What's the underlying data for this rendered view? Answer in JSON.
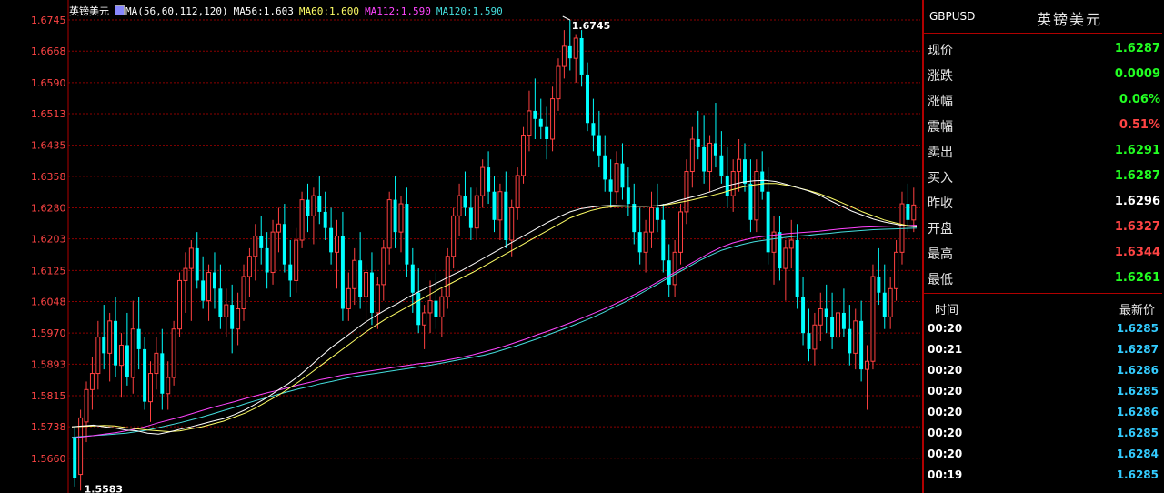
{
  "chart_data": {
    "type": "candlestick",
    "symbol_title": "英镑美元",
    "legend": {
      "ma_params": "MA(56,60,112,120)",
      "ma56": "MA56:1.603",
      "ma60": "MA60:1.600",
      "ma112": "MA112:1.590",
      "ma120": "MA120:1.590"
    },
    "y_ticks": [
      "1.6745",
      "1.6668",
      "1.6590",
      "1.6513",
      "1.6435",
      "1.6358",
      "1.6280",
      "1.6203",
      "1.6125",
      "1.6048",
      "1.5970",
      "1.5893",
      "1.5815",
      "1.5738",
      "1.5660"
    ],
    "ylim": [
      1.5583,
      1.6745
    ],
    "high_label": "1.6745",
    "low_label": "1.5583",
    "colors": {
      "up": "#ff4040",
      "down": "#00ffff",
      "ma56": "#ffffff",
      "ma60": "#ffff66",
      "ma112": "#ff44ff",
      "ma120": "#44dddd",
      "grid": "#8b0000"
    },
    "candles": [
      [
        1.571,
        1.574,
        1.559,
        1.561
      ],
      [
        1.562,
        1.578,
        1.558,
        1.576
      ],
      [
        1.575,
        1.585,
        1.57,
        1.583
      ],
      [
        1.583,
        1.591,
        1.578,
        1.587
      ],
      [
        1.587,
        1.6,
        1.583,
        1.596
      ],
      [
        1.596,
        1.604,
        1.588,
        1.592
      ],
      [
        1.592,
        1.602,
        1.585,
        1.6
      ],
      [
        1.6,
        1.606,
        1.586,
        1.589
      ],
      [
        1.589,
        1.597,
        1.581,
        1.594
      ],
      [
        1.594,
        1.602,
        1.584,
        1.586
      ],
      [
        1.586,
        1.605,
        1.582,
        1.598
      ],
      [
        1.598,
        1.606,
        1.588,
        1.593
      ],
      [
        1.593,
        1.596,
        1.578,
        1.58
      ],
      [
        1.58,
        1.59,
        1.575,
        1.587
      ],
      [
        1.587,
        1.596,
        1.583,
        1.592
      ],
      [
        1.592,
        1.598,
        1.578,
        1.582
      ],
      [
        1.582,
        1.59,
        1.578,
        1.586
      ],
      [
        1.586,
        1.6,
        1.584,
        1.598
      ],
      [
        1.598,
        1.612,
        1.596,
        1.61
      ],
      [
        1.61,
        1.617,
        1.602,
        1.613
      ],
      [
        1.613,
        1.62,
        1.6,
        1.618
      ],
      [
        1.618,
        1.622,
        1.608,
        1.61
      ],
      [
        1.61,
        1.616,
        1.603,
        1.605
      ],
      [
        1.605,
        1.614,
        1.6,
        1.612
      ],
      [
        1.612,
        1.617,
        1.603,
        1.608
      ],
      [
        1.608,
        1.614,
        1.598,
        1.601
      ],
      [
        1.601,
        1.608,
        1.596,
        1.604
      ],
      [
        1.604,
        1.609,
        1.592,
        1.598
      ],
      [
        1.598,
        1.607,
        1.594,
        1.603
      ],
      [
        1.603,
        1.614,
        1.6,
        1.611
      ],
      [
        1.611,
        1.618,
        1.606,
        1.616
      ],
      [
        1.616,
        1.624,
        1.61,
        1.621
      ],
      [
        1.621,
        1.626,
        1.614,
        1.618
      ],
      [
        1.618,
        1.622,
        1.608,
        1.612
      ],
      [
        1.612,
        1.625,
        1.609,
        1.622
      ],
      [
        1.622,
        1.628,
        1.617,
        1.624
      ],
      [
        1.624,
        1.629,
        1.612,
        1.614
      ],
      [
        1.614,
        1.62,
        1.606,
        1.61
      ],
      [
        1.61,
        1.623,
        1.607,
        1.62
      ],
      [
        1.62,
        1.632,
        1.618,
        1.63
      ],
      [
        1.63,
        1.634,
        1.622,
        1.626
      ],
      [
        1.626,
        1.633,
        1.619,
        1.631
      ],
      [
        1.631,
        1.636,
        1.624,
        1.627
      ],
      [
        1.627,
        1.632,
        1.62,
        1.623
      ],
      [
        1.623,
        1.628,
        1.614,
        1.617
      ],
      [
        1.617,
        1.625,
        1.608,
        1.621
      ],
      [
        1.621,
        1.627,
        1.6,
        1.603
      ],
      [
        1.603,
        1.612,
        1.6,
        1.608
      ],
      [
        1.608,
        1.618,
        1.604,
        1.615
      ],
      [
        1.615,
        1.622,
        1.603,
        1.606
      ],
      [
        1.606,
        1.614,
        1.598,
        1.612
      ],
      [
        1.612,
        1.617,
        1.599,
        1.602
      ],
      [
        1.602,
        1.611,
        1.598,
        1.609
      ],
      [
        1.609,
        1.62,
        1.605,
        1.618
      ],
      [
        1.618,
        1.632,
        1.614,
        1.63
      ],
      [
        1.63,
        1.636,
        1.618,
        1.622
      ],
      [
        1.622,
        1.631,
        1.617,
        1.629
      ],
      [
        1.629,
        1.633,
        1.611,
        1.614
      ],
      [
        1.614,
        1.618,
        1.602,
        1.607
      ],
      [
        1.607,
        1.613,
        1.597,
        1.599
      ],
      [
        1.599,
        1.604,
        1.593,
        1.602
      ],
      [
        1.602,
        1.61,
        1.597,
        1.605
      ],
      [
        1.605,
        1.612,
        1.598,
        1.601
      ],
      [
        1.601,
        1.608,
        1.596,
        1.606
      ],
      [
        1.606,
        1.618,
        1.603,
        1.616
      ],
      [
        1.616,
        1.628,
        1.613,
        1.626
      ],
      [
        1.626,
        1.634,
        1.621,
        1.631
      ],
      [
        1.631,
        1.637,
        1.626,
        1.628
      ],
      [
        1.628,
        1.633,
        1.62,
        1.623
      ],
      [
        1.623,
        1.633,
        1.62,
        1.631
      ],
      [
        1.631,
        1.64,
        1.628,
        1.638
      ],
      [
        1.638,
        1.642,
        1.629,
        1.632
      ],
      [
        1.632,
        1.636,
        1.622,
        1.625
      ],
      [
        1.625,
        1.634,
        1.62,
        1.632
      ],
      [
        1.632,
        1.637,
        1.618,
        1.62
      ],
      [
        1.62,
        1.63,
        1.616,
        1.628
      ],
      [
        1.628,
        1.638,
        1.625,
        1.636
      ],
      [
        1.636,
        1.648,
        1.634,
        1.646
      ],
      [
        1.646,
        1.657,
        1.642,
        1.652
      ],
      [
        1.652,
        1.66,
        1.645,
        1.65
      ],
      [
        1.65,
        1.655,
        1.645,
        1.648
      ],
      [
        1.648,
        1.653,
        1.64,
        1.645
      ],
      [
        1.645,
        1.658,
        1.642,
        1.655
      ],
      [
        1.655,
        1.665,
        1.652,
        1.663
      ],
      [
        1.663,
        1.672,
        1.66,
        1.668
      ],
      [
        1.668,
        1.6745,
        1.662,
        1.665
      ],
      [
        1.665,
        1.671,
        1.659,
        1.67
      ],
      [
        1.67,
        1.672,
        1.658,
        1.661
      ],
      [
        1.661,
        1.664,
        1.647,
        1.649
      ],
      [
        1.649,
        1.655,
        1.642,
        1.646
      ],
      [
        1.646,
        1.652,
        1.638,
        1.641
      ],
      [
        1.641,
        1.646,
        1.632,
        1.635
      ],
      [
        1.635,
        1.64,
        1.628,
        1.632
      ],
      [
        1.632,
        1.642,
        1.629,
        1.639
      ],
      [
        1.639,
        1.644,
        1.63,
        1.633
      ],
      [
        1.633,
        1.638,
        1.626,
        1.629
      ],
      [
        1.629,
        1.634,
        1.619,
        1.622
      ],
      [
        1.622,
        1.628,
        1.614,
        1.617
      ],
      [
        1.617,
        1.625,
        1.612,
        1.622
      ],
      [
        1.622,
        1.632,
        1.618,
        1.628
      ],
      [
        1.628,
        1.634,
        1.622,
        1.625
      ],
      [
        1.625,
        1.629,
        1.612,
        1.615
      ],
      [
        1.615,
        1.619,
        1.606,
        1.609
      ],
      [
        1.609,
        1.62,
        1.606,
        1.617
      ],
      [
        1.617,
        1.629,
        1.614,
        1.627
      ],
      [
        1.627,
        1.64,
        1.624,
        1.637
      ],
      [
        1.637,
        1.648,
        1.633,
        1.645
      ],
      [
        1.645,
        1.652,
        1.64,
        1.643
      ],
      [
        1.643,
        1.651,
        1.634,
        1.637
      ],
      [
        1.637,
        1.646,
        1.632,
        1.644
      ],
      [
        1.644,
        1.654,
        1.638,
        1.641
      ],
      [
        1.641,
        1.647,
        1.634,
        1.636
      ],
      [
        1.636,
        1.643,
        1.628,
        1.631
      ],
      [
        1.631,
        1.64,
        1.627,
        1.637
      ],
      [
        1.637,
        1.645,
        1.632,
        1.64
      ],
      [
        1.64,
        1.644,
        1.632,
        1.634
      ],
      [
        1.634,
        1.64,
        1.622,
        1.625
      ],
      [
        1.625,
        1.64,
        1.622,
        1.637
      ],
      [
        1.637,
        1.642,
        1.63,
        1.632
      ],
      [
        1.632,
        1.638,
        1.614,
        1.617
      ],
      [
        1.617,
        1.626,
        1.609,
        1.622
      ],
      [
        1.622,
        1.626,
        1.61,
        1.613
      ],
      [
        1.613,
        1.62,
        1.605,
        1.618
      ],
      [
        1.618,
        1.625,
        1.613,
        1.62
      ],
      [
        1.62,
        1.624,
        1.603,
        1.606
      ],
      [
        1.606,
        1.611,
        1.594,
        1.597
      ],
      [
        1.597,
        1.603,
        1.59,
        1.593
      ],
      [
        1.593,
        1.602,
        1.589,
        1.599
      ],
      [
        1.599,
        1.607,
        1.595,
        1.603
      ],
      [
        1.603,
        1.609,
        1.597,
        1.601
      ],
      [
        1.601,
        1.607,
        1.593,
        1.596
      ],
      [
        1.596,
        1.604,
        1.592,
        1.602
      ],
      [
        1.602,
        1.608,
        1.596,
        1.598
      ],
      [
        1.598,
        1.604,
        1.589,
        1.592
      ],
      [
        1.592,
        1.603,
        1.588,
        1.6
      ],
      [
        1.6,
        1.605,
        1.585,
        1.588
      ],
      [
        1.588,
        1.594,
        1.578,
        1.59
      ],
      [
        1.59,
        1.614,
        1.588,
        1.611
      ],
      [
        1.611,
        1.618,
        1.604,
        1.607
      ],
      [
        1.607,
        1.614,
        1.598,
        1.601
      ],
      [
        1.601,
        1.611,
        1.598,
        1.608
      ],
      [
        1.608,
        1.62,
        1.605,
        1.617
      ],
      [
        1.617,
        1.632,
        1.614,
        1.629
      ],
      [
        1.629,
        1.634,
        1.622,
        1.625
      ],
      [
        1.625,
        1.633,
        1.622,
        1.6287
      ]
    ],
    "ma56": [
      1.5738,
      1.574,
      1.5742,
      1.5738,
      1.5735,
      1.573,
      1.5728,
      1.5722,
      1.572,
      1.5725,
      1.5732,
      1.5738,
      1.5745,
      1.5752,
      1.5758,
      1.5768,
      1.578,
      1.5795,
      1.581,
      1.5828,
      1.5845,
      1.5865,
      1.5888,
      1.5912,
      1.5935,
      1.5955,
      1.5975,
      1.5995,
      1.6012,
      1.6028,
      1.6042,
      1.6058,
      1.6072,
      1.6085,
      1.6098,
      1.6112,
      1.6125,
      1.614,
      1.6155,
      1.617,
      1.6185,
      1.62,
      1.6215,
      1.623,
      1.6245,
      1.6258,
      1.627,
      1.6278,
      1.6282,
      1.6285,
      1.6286,
      1.6285,
      1.6284,
      1.6284,
      1.6285,
      1.629,
      1.6298,
      1.6305,
      1.6312,
      1.632,
      1.633,
      1.6338,
      1.6344,
      1.6347,
      1.6348,
      1.6345,
      1.6338,
      1.633,
      1.6322,
      1.6312,
      1.6298,
      1.6285,
      1.6272,
      1.6262,
      1.6252,
      1.6245,
      1.624,
      1.6235,
      1.6233
    ],
    "ma60": [
      1.5738,
      1.5739,
      1.574,
      1.5741,
      1.574,
      1.5736,
      1.5733,
      1.573,
      1.5728,
      1.5726,
      1.5728,
      1.5733,
      1.5738,
      1.5745,
      1.5752,
      1.5762,
      1.5772,
      1.5785,
      1.58,
      1.5815,
      1.5832,
      1.585,
      1.587,
      1.589,
      1.591,
      1.593,
      1.595,
      1.597,
      1.5988,
      1.6005,
      1.602,
      1.6035,
      1.605,
      1.6065,
      1.608,
      1.6093,
      1.6107,
      1.612,
      1.6135,
      1.615,
      1.6165,
      1.618,
      1.6195,
      1.621,
      1.6225,
      1.624,
      1.6255,
      1.6265,
      1.6274,
      1.628,
      1.6283,
      1.6284,
      1.6284,
      1.6284,
      1.6285,
      1.6288,
      1.6293,
      1.6298,
      1.6304,
      1.631,
      1.6317,
      1.6325,
      1.6332,
      1.6337,
      1.634,
      1.634,
      1.6336,
      1.633,
      1.6323,
      1.6315,
      1.6305,
      1.6294,
      1.6282,
      1.627,
      1.626,
      1.625,
      1.6243,
      1.6237,
      1.6233
    ],
    "ma112": [
      1.571,
      1.5713,
      1.5716,
      1.572,
      1.5723,
      1.5728,
      1.5733,
      1.574,
      1.5748,
      1.5755,
      1.5762,
      1.577,
      1.5778,
      1.5786,
      1.5793,
      1.58,
      1.5808,
      1.5815,
      1.5822,
      1.5828,
      1.5835,
      1.5842,
      1.5848,
      1.5855,
      1.586,
      1.5866,
      1.587,
      1.5874,
      1.5878,
      1.5882,
      1.5886,
      1.589,
      1.5894,
      1.5897,
      1.59,
      1.5905,
      1.591,
      1.5916,
      1.5923,
      1.593,
      1.5938,
      1.5947,
      1.5956,
      1.5966,
      1.5975,
      1.5985,
      1.5995,
      1.6006,
      1.6017,
      1.6028,
      1.604,
      1.6053,
      1.6066,
      1.608,
      1.6095,
      1.611,
      1.6125,
      1.614,
      1.6155,
      1.617,
      1.6183,
      1.6193,
      1.62,
      1.6206,
      1.621,
      1.6213,
      1.6216,
      1.6218,
      1.622,
      1.6222,
      1.6225,
      1.6228,
      1.623,
      1.6232,
      1.6233,
      1.6234,
      1.6235,
      1.6236,
      1.6237
    ],
    "ma120": [
      1.5712,
      1.5714,
      1.5716,
      1.5718,
      1.572,
      1.5722,
      1.5726,
      1.573,
      1.5736,
      1.5742,
      1.5748,
      1.5755,
      1.5762,
      1.577,
      1.5778,
      1.5786,
      1.5795,
      1.5803,
      1.581,
      1.5818,
      1.5825,
      1.5832,
      1.5838,
      1.5845,
      1.585,
      1.5856,
      1.5862,
      1.5866,
      1.587,
      1.5874,
      1.5878,
      1.5882,
      1.5886,
      1.589,
      1.5895,
      1.59,
      1.5905,
      1.591,
      1.5915,
      1.5922,
      1.593,
      1.5938,
      1.5947,
      1.5956,
      1.5966,
      1.5976,
      1.5986,
      1.5997,
      1.6008,
      1.602,
      1.6033,
      1.6046,
      1.606,
      1.6075,
      1.609,
      1.6106,
      1.612,
      1.6135,
      1.615,
      1.6163,
      1.6175,
      1.6183,
      1.619,
      1.6196,
      1.62,
      1.6204,
      1.6207,
      1.621,
      1.6212,
      1.6215,
      1.6217,
      1.622,
      1.6222,
      1.6224,
      1.6226,
      1.6227,
      1.6228,
      1.6229,
      1.623
    ]
  },
  "panel": {
    "code": "GBPUSD",
    "name": "英镑美元",
    "rows": [
      {
        "label": "现价",
        "value": "1.6287",
        "color": "#22ff22"
      },
      {
        "label": "涨跌",
        "value": "0.0009",
        "color": "#22ff22"
      },
      {
        "label": "涨幅",
        "value": "0.06%",
        "color": "#22ff22"
      },
      {
        "label": "震幅",
        "value": "0.51%",
        "color": "#ff4444"
      },
      {
        "label": "卖出",
        "value": "1.6291",
        "color": "#22ff22"
      },
      {
        "label": "买入",
        "value": "1.6287",
        "color": "#22ff22"
      },
      {
        "label": "昨收",
        "value": "1.6296",
        "color": "#ffffff"
      },
      {
        "label": "开盘",
        "value": "1.6327",
        "color": "#ff4444"
      },
      {
        "label": "最高",
        "value": "1.6344",
        "color": "#ff4444"
      },
      {
        "label": "最低",
        "value": "1.6261",
        "color": "#22ff22"
      }
    ],
    "trades_header": {
      "time": "时间",
      "price": "最新价"
    },
    "trades": [
      {
        "time": "00:20",
        "price": "1.6285"
      },
      {
        "time": "00:21",
        "price": "1.6287"
      },
      {
        "time": "00:20",
        "price": "1.6286"
      },
      {
        "time": "00:20",
        "price": "1.6285"
      },
      {
        "time": "00:20",
        "price": "1.6286"
      },
      {
        "time": "00:20",
        "price": "1.6285"
      },
      {
        "time": "00:20",
        "price": "1.6284"
      },
      {
        "time": "00:19",
        "price": "1.6285"
      }
    ]
  }
}
